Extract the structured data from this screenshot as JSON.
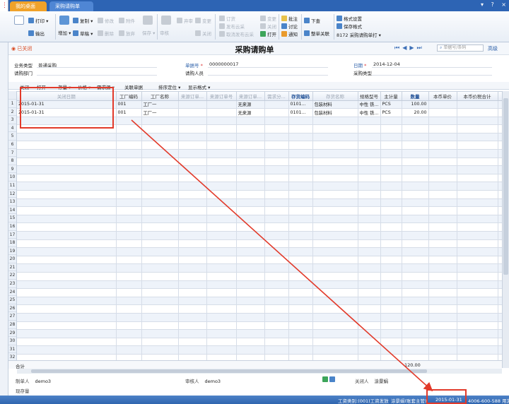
{
  "tabs": [
    {
      "label": "我的桌面"
    },
    {
      "label": "采购请购单",
      "close": "×"
    }
  ],
  "window_controls": [
    "▾",
    "?",
    "×"
  ],
  "toolbar": {
    "add_label": "增加",
    "print_label": "打印",
    "output_label": "输出",
    "copy_label": "复制",
    "modify_label": "修改",
    "attach_label": "附件",
    "draft_label": "草稿",
    "delete_label": "删除",
    "abandon_label": "放弃",
    "save_label": "保存",
    "audit_label": "审核",
    "unaudit_label": "弃审",
    "change_label": "变更",
    "close_label": "关闭",
    "open_label": "打开",
    "locate_label": "定位",
    "order_label": "订货",
    "publish_label": "发布云采",
    "cancel_publish_label": "取消发布云采",
    "approve_label": "批注",
    "discuss_label": "讨论",
    "notify_label": "通知",
    "download_label": "下查",
    "related_label": "整单关联",
    "format_settings_label": "格式设置",
    "save_format_label": "保存格式",
    "format_name": "8172 采购请购单打"
  },
  "doc": {
    "status": "已关闭",
    "title": "采购请购单",
    "nav_search_placeholder": "单据号/条码",
    "refresh_label": "高级"
  },
  "header_fields": {
    "biz_type_label": "业务类型",
    "biz_type_value": "普通采购",
    "doc_no_label": "单据号",
    "doc_no_value": "0000000017",
    "date_label": "日期",
    "date_value": "2014-12-04",
    "dept_label": "请购部门",
    "person_label": "请购人员",
    "purchase_type_label": "采购类型"
  },
  "grid_toolbar": [
    "关闭",
    "打开",
    "存量",
    "价格",
    "需求源",
    "关联单据",
    "排序定位",
    "显示格式"
  ],
  "grid": {
    "columns": [
      "关闭日期",
      "工厂编码",
      "工厂名称",
      "来源订单...",
      "来源订单号",
      "来源订单...",
      "需求分...",
      "存货编码",
      "存货名称",
      "规格型号",
      "主计量",
      "数量",
      "本币单价",
      "本币价税合计",
      "税率"
    ],
    "rows": [
      [
        "2015-01-31",
        "001",
        "工厂一",
        "",
        "",
        "无来源",
        "",
        "0101...",
        "包装材料",
        "中性 铁...",
        "PCS",
        "100.00",
        "",
        "",
        "17"
      ],
      [
        "2015-01-31",
        "001",
        "工厂一",
        "",
        "",
        "无来源",
        "",
        "0101...",
        "包装材料",
        "中性 铁...",
        "PCS",
        "20.00",
        "",
        "",
        "17"
      ]
    ],
    "row_numbers": [
      "1",
      "2",
      "3",
      "4",
      "5",
      "6",
      "7",
      "8",
      "9",
      "10",
      "11",
      "12",
      "13",
      "14",
      "15",
      "16",
      "17",
      "18",
      "19",
      "20",
      "21",
      "22",
      "23",
      "24",
      "25",
      "26",
      "27",
      "28",
      "29",
      "30",
      "31",
      "32",
      "33"
    ],
    "sum_label": "合计",
    "sum_qty": "120.00"
  },
  "footer": {
    "maker_label": "制单人",
    "maker_value": "demo3",
    "auditor_label": "审核人",
    "auditor_value": "demo3",
    "closer_label": "关闭人",
    "closer_value": "涂景娟",
    "stock_label": "现存量"
  },
  "statusbar": {
    "type": "工资类别:(001)工资发放",
    "user": "涂景娟(账套主管)",
    "date": "2015-01-31",
    "phone": "4006-600-588 用友"
  },
  "colors": {
    "accent": "#2d64b4",
    "tab_orange": "#f0a22a",
    "annotation": "#e23a2a"
  }
}
